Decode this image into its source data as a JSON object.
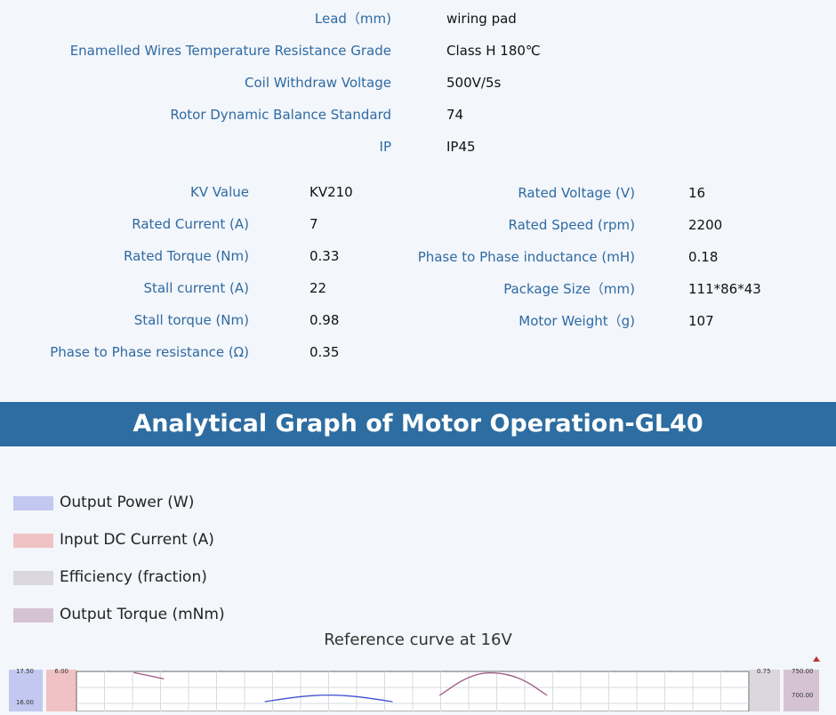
{
  "spec_top": [
    {
      "label": "Lead（mm)",
      "value": "wiring pad"
    },
    {
      "label": "Enamelled Wires Temperature Resistance Grade",
      "value": "Class H 180℃"
    },
    {
      "label": "Coil Withdraw Voltage",
      "value": "500V/5s"
    },
    {
      "label": "Rotor Dynamic Balance Standard",
      "value": "74"
    },
    {
      "label": "IP",
      "value": "IP45"
    }
  ],
  "spec_left": [
    {
      "label": "KV Value",
      "value": "KV210"
    },
    {
      "label": "Rated Current (A)",
      "value": "7"
    },
    {
      "label": "Rated  Torque (Nm)",
      "value": "0.33"
    },
    {
      "label": "Stall current (A)",
      "value": "22"
    },
    {
      "label": "Stall torque (Nm)",
      "value": "0.98"
    },
    {
      "label": "Phase to Phase resistance (Ω)",
      "value": "0.35"
    }
  ],
  "spec_right": [
    {
      "label": "Rated Voltage (V)",
      "value": "16"
    },
    {
      "label": "Rated Speed (rpm)",
      "value": "2200"
    },
    {
      "label": "Phase to Phase inductance (mH)",
      "value": "0.18"
    },
    {
      "label": "Package Size（mm)",
      "value": "111*86*43"
    },
    {
      "label": "Motor Weight（g)",
      "value": "107"
    }
  ],
  "banner": {
    "title": "Analytical Graph of Motor Operation-GL40"
  },
  "legend": [
    {
      "label": "Output Power (W)",
      "color": "#c2c8f0"
    },
    {
      "label": "Input DC Current (A)",
      "color": "#f0c2c4"
    },
    {
      "label": "Efficiency (fraction)",
      "color": "#dcd6e0"
    },
    {
      "label": "Output Torque (mNm)",
      "color": "#d5c3d3"
    }
  ],
  "chart_data": {
    "type": "line",
    "title": "Reference curve at 16V",
    "axes": {
      "power": {
        "ticks": [
          "17.50",
          "16.00"
        ],
        "color": "#c2c8f0"
      },
      "current": {
        "ticks": [
          "6.00"
        ],
        "color": "#f0c2c4"
      },
      "efficiency": {
        "ticks": [
          "0.75"
        ],
        "color": "#dcd6e0"
      },
      "torque": {
        "ticks": [
          "750.00",
          "700.00"
        ],
        "color": "#d5c3d3"
      }
    },
    "series": [
      {
        "name": "Output Power (W)",
        "color": "#3d4fd0",
        "x": [
          0.28,
          0.33,
          0.375,
          0.42,
          0.47
        ],
        "y": [
          16.0,
          16.25,
          16.35,
          16.25,
          16.0
        ]
      },
      {
        "name": "Output Torque (mNm)",
        "color": "#9a5a80",
        "x": [
          0.54,
          0.58,
          0.615,
          0.66,
          0.7
        ],
        "y": [
          700.0,
          738.0,
          750.0,
          738.0,
          700.0
        ]
      },
      {
        "name": "Input DC Current (A)",
        "color": "#9a5a80",
        "x": [
          0.085,
          0.13
        ],
        "y": [
          5.9,
          5.3
        ]
      }
    ]
  }
}
